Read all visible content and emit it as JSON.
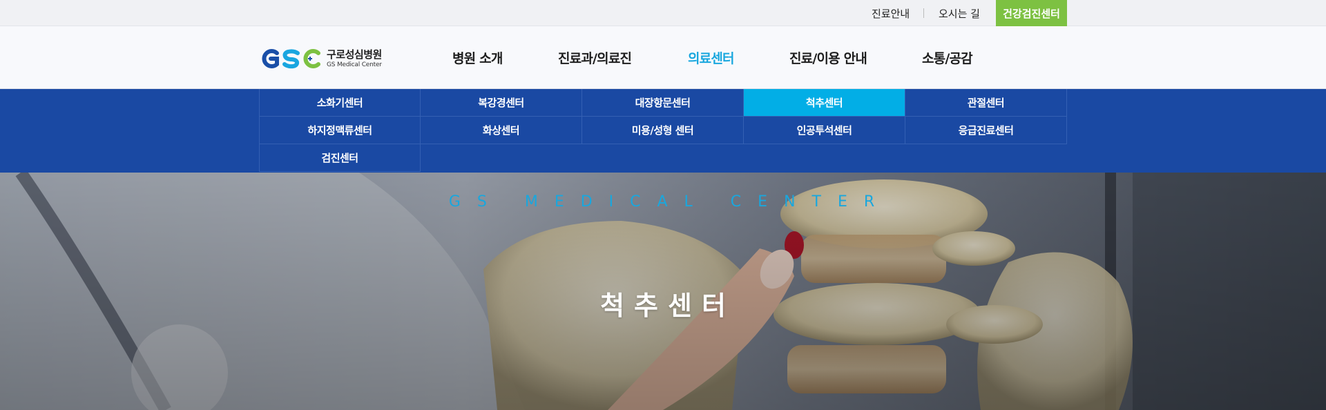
{
  "topbar": {
    "links": [
      {
        "label": "진료안내"
      },
      {
        "label": "오시는 길"
      }
    ],
    "checkup_button": "건강검진센터",
    "checkup_color": "#7dc142"
  },
  "logo": {
    "mark": "GSC",
    "name_ko": "구로성심병원",
    "name_en": "GS Medical Center"
  },
  "gnb": [
    {
      "label": "병원 소개"
    },
    {
      "label": "진료과/의료진"
    },
    {
      "label": "의료센터",
      "active": true
    },
    {
      "label": "진료/이용 안내"
    },
    {
      "label": "소통/공감"
    }
  ],
  "submenu": {
    "items": [
      {
        "label": "소화기센터"
      },
      {
        "label": "복강경센터"
      },
      {
        "label": "대장항문센터"
      },
      {
        "label": "척추센터",
        "active": true
      },
      {
        "label": "관절센터"
      },
      {
        "label": "하지정맥류센터"
      },
      {
        "label": "화상센터"
      },
      {
        "label": "미용/성형 센터"
      },
      {
        "label": "인공투석센터"
      },
      {
        "label": "응급진료센터"
      },
      {
        "label": "검진센터"
      }
    ]
  },
  "hero": {
    "subtitle": "GS MEDICAL CENTER",
    "title": "척추센터"
  },
  "colors": {
    "accent": "#19a7de",
    "submenu_bg": "#1a49a3",
    "submenu_active": "#02aee6"
  }
}
